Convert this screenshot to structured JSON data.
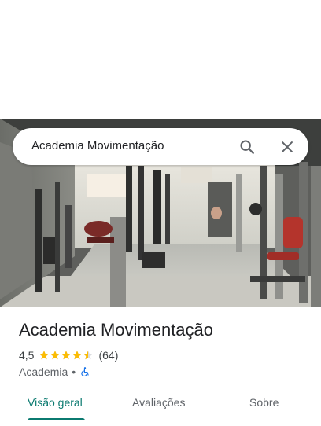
{
  "search": {
    "query": "Academia Movimentação",
    "search_icon": "search-icon",
    "close_icon": "close-icon"
  },
  "place": {
    "photo_icon": "gym-photo",
    "name": "Academia Movimentação",
    "rating": "4,5",
    "stars": 4.5,
    "reviews_count": "(64)",
    "category": "Academia",
    "separator": "•",
    "accessibility_icon": "wheelchair-icon"
  },
  "tabs": [
    {
      "label": "Visão geral",
      "active": true
    },
    {
      "label": "Avaliações",
      "active": false
    },
    {
      "label": "Sobre",
      "active": false
    }
  ],
  "colors": {
    "accent": "#0b7a70",
    "star": "#fbbc04",
    "accessibility": "#1a73e8"
  }
}
